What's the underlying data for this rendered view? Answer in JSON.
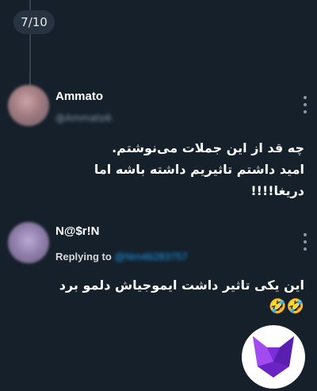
{
  "thread": {
    "page_indicator": "7/10"
  },
  "tweets": [
    {
      "name": "Ammato",
      "handle": "@Ammato6",
      "text_lines": [
        "چه قد از این جملات می‌نوشتم.",
        "امید داشتم تاثیریم داشته باشه اما",
        "دریغا!!!!"
      ]
    },
    {
      "name": "N@$r!N",
      "replying_label": "Replying to",
      "replying_handle": "@Nrn46283757",
      "text_lines": [
        "این یکی تاثیر داشت ایموجیاش دلمو برد",
        "🤣🤣"
      ]
    }
  ],
  "icons": {
    "more": "more-vertical-icon",
    "logo": "fox-logo"
  },
  "colors": {
    "background": "#15202b",
    "thread_line": "#38444d",
    "link": "#1d9bf0",
    "logo_purple": "#8a2be2"
  }
}
